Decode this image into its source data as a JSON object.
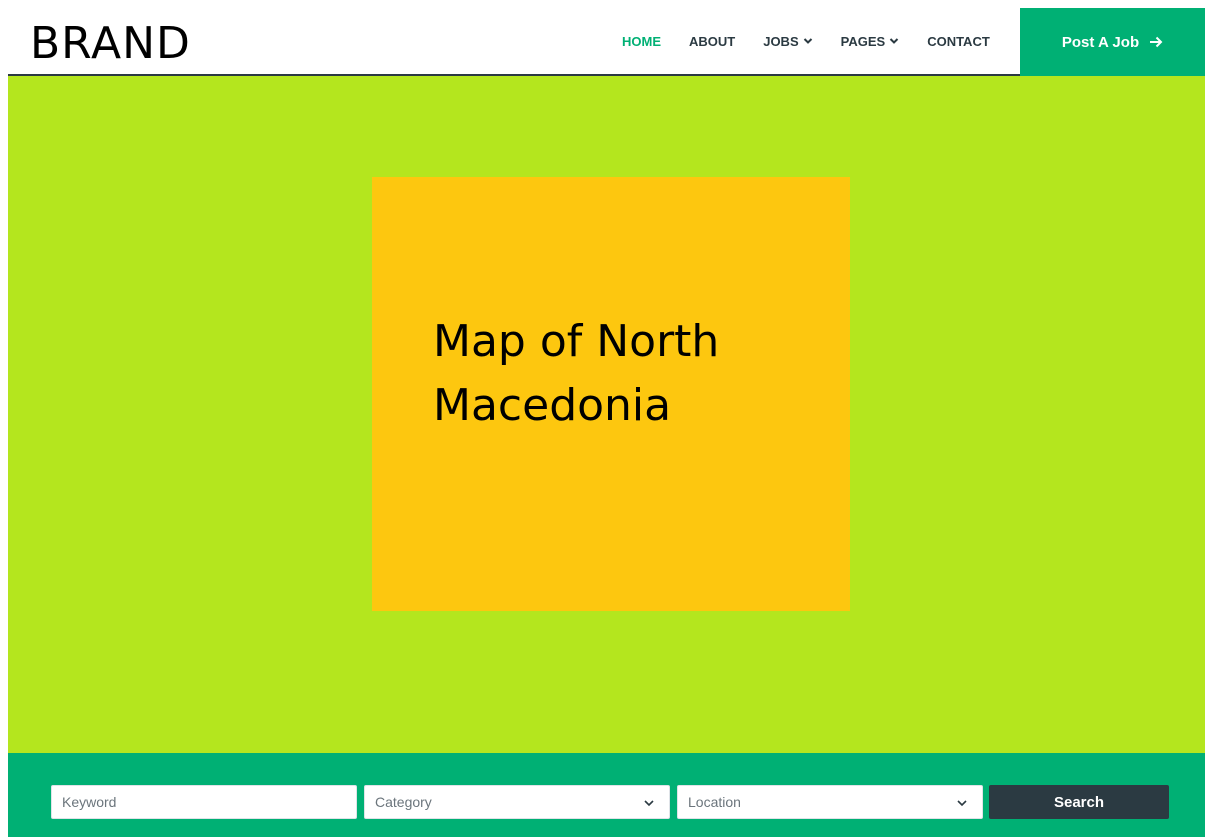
{
  "navbar": {
    "brand": "BRAND",
    "links": [
      {
        "label": "HOME",
        "active": true
      },
      {
        "label": "ABOUT"
      },
      {
        "label": "JOBS",
        "dropdown": true
      },
      {
        "label": "PAGES",
        "dropdown": true
      },
      {
        "label": "CONTACT"
      }
    ],
    "cta_label": "Post A Job"
  },
  "hero": {
    "map_title": "Map of North Macedonia"
  },
  "search": {
    "keyword_placeholder": "Keyword",
    "category_selected": "Category",
    "location_selected": "Location",
    "button_label": "Search"
  },
  "colors": {
    "accent": "#00b074",
    "dark": "#2b3a42",
    "hero_bg": "#b4e61e",
    "map_bg": "#fdc70f"
  }
}
